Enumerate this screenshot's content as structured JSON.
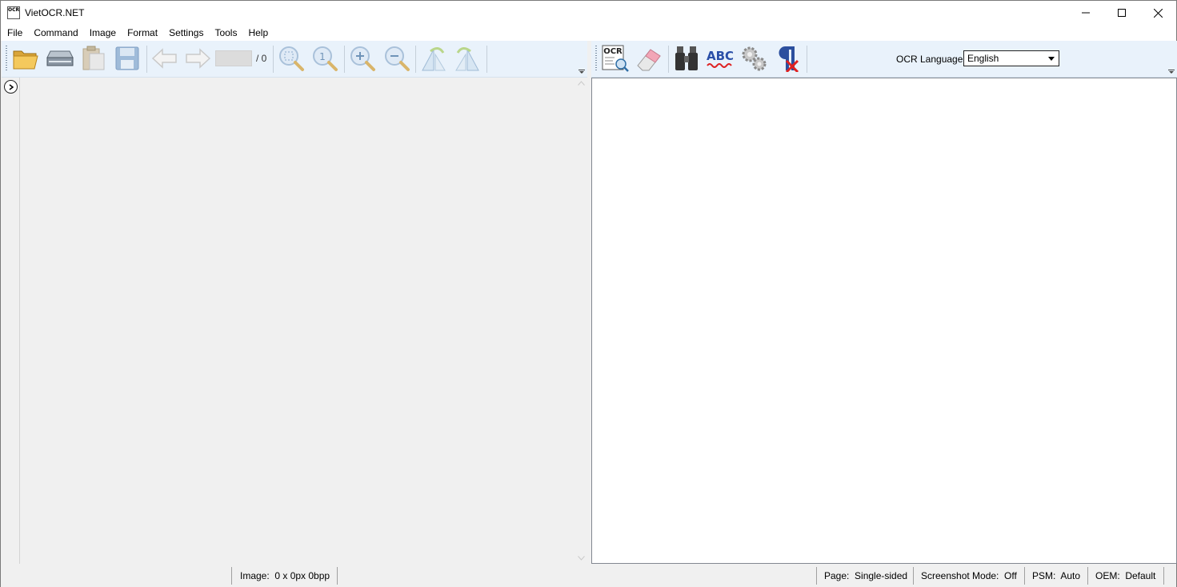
{
  "window": {
    "title": "VietOCR.NET",
    "icon_text": "OCR"
  },
  "menu": [
    "File",
    "Command",
    "Image",
    "Format",
    "Settings",
    "Tools",
    "Help"
  ],
  "left_toolbar": {
    "icons": [
      "open-folder-icon",
      "scan-icon",
      "paste-icon",
      "save-icon",
      "back-icon",
      "forward-icon",
      "fit-image-icon",
      "actual-size-icon",
      "zoom-in-icon",
      "zoom-out-icon",
      "rotate-left-icon",
      "rotate-right-icon"
    ],
    "page_number": "",
    "page_total": "/ 0"
  },
  "right_toolbar": {
    "icons": [
      "ocr-icon",
      "eraser-icon",
      "binoculars-icon",
      "spellcheck-icon",
      "gear-icon",
      "remove-linebreaks-icon"
    ],
    "ocr_language_label": "OCR Language",
    "ocr_language_value": "English"
  },
  "status": {
    "image": "Image:  0 x 0px 0bpp",
    "page": "Page:  Single-sided",
    "screenshot_mode": "Screenshot Mode:  Off",
    "psm": "PSM:  Auto",
    "oem": "OEM:  Default"
  },
  "colors": {
    "toolbar_bg": "#e9f2fb",
    "window_bg": "#f0f0f0",
    "text_pane_bg": "#ffffff"
  }
}
